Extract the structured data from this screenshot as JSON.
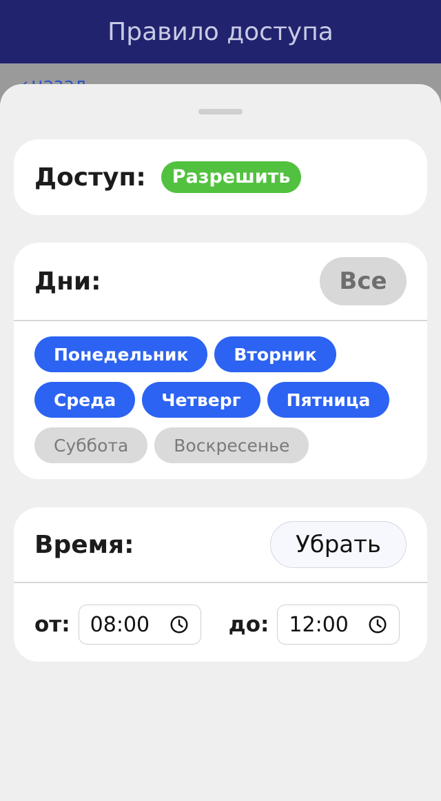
{
  "header": {
    "title": "Правило доступа"
  },
  "behind": {
    "back_label": "назад"
  },
  "access": {
    "label": "Доступ:",
    "value": "Разрешить",
    "value_color": "#52c13f"
  },
  "days": {
    "label": "Дни:",
    "all_button": "Все",
    "items": [
      {
        "label": "Понедельник",
        "selected": true
      },
      {
        "label": "Вторник",
        "selected": true
      },
      {
        "label": "Среда",
        "selected": true
      },
      {
        "label": "Четверг",
        "selected": true
      },
      {
        "label": "Пятница",
        "selected": true
      },
      {
        "label": "Суббота",
        "selected": false
      },
      {
        "label": "Воскресенье",
        "selected": false
      }
    ],
    "selected_color": "#2c63f2"
  },
  "time": {
    "label": "Время:",
    "remove_button": "Убрать",
    "from_label": "от:",
    "from_value": "08:00",
    "to_label": "до:",
    "to_value": "12:00",
    "clock_icon": "clock-icon"
  },
  "colors": {
    "header_bg": "#22236e",
    "sheet_bg": "#efefef"
  }
}
